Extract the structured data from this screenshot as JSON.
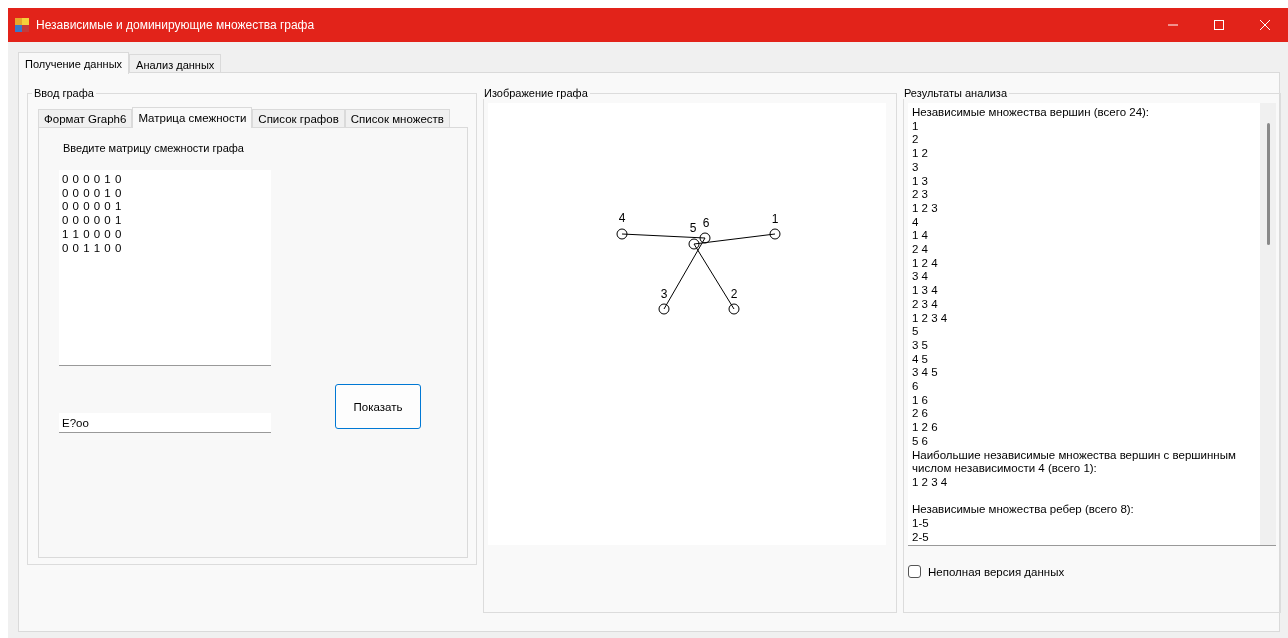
{
  "window": {
    "title": "Независимые и доминирующие множества графа"
  },
  "tabs": [
    {
      "label": "Получение данных",
      "selected": true
    },
    {
      "label": "Анализ данных",
      "selected": false
    }
  ],
  "input_group": {
    "title": "Ввод графа",
    "tabs": [
      {
        "label": "Формат Graph6",
        "selected": false
      },
      {
        "label": "Матрица смежности",
        "selected": true
      },
      {
        "label": "Список графов",
        "selected": false
      },
      {
        "label": "Список множеств",
        "selected": false
      }
    ],
    "prompt": "Введите матрицу смежности графа",
    "matrix": [
      "0 0 0 0 1 0",
      "0 0 0 0 1 0",
      "0 0 0 0 0 1",
      "0 0 0 0 0 1",
      "1 1 0 0 0 0",
      "0 0 1 1 0 0"
    ],
    "graph6": "E?oo",
    "show_button": "Показать"
  },
  "image_group": {
    "title": "Изображение графа",
    "nodes": [
      "1",
      "2",
      "3",
      "4",
      "5",
      "6"
    ]
  },
  "results_group": {
    "title": "Результаты анализа",
    "sections": [
      {
        "heading": "Независимые множества вершин (всего 24):",
        "spaced": false,
        "lines": [
          "1",
          "2",
          "1 2",
          "3",
          "1 3",
          "2 3",
          "1 2 3",
          "4",
          "1 4",
          "2 4",
          "1 2 4",
          "3 4",
          "1 3 4",
          "2 3 4",
          "1 2 3 4",
          "5",
          "3 5",
          "4 5",
          "3 4 5",
          "6",
          "1 6",
          "2 6",
          "1 2 6",
          "5 6"
        ]
      },
      {
        "heading": "Наибольшие независимые множества вершин с вершинным числом независимости 4 (всего 1):",
        "spaced": false,
        "lines": [
          "1 2 3 4"
        ]
      },
      {
        "heading": "Независимые множества ребер (всего 8):",
        "spaced": true,
        "lines": [
          "1-5",
          "2-5"
        ]
      }
    ],
    "partial_checkbox": {
      "label": "Неполная версия данных",
      "checked": false
    }
  }
}
